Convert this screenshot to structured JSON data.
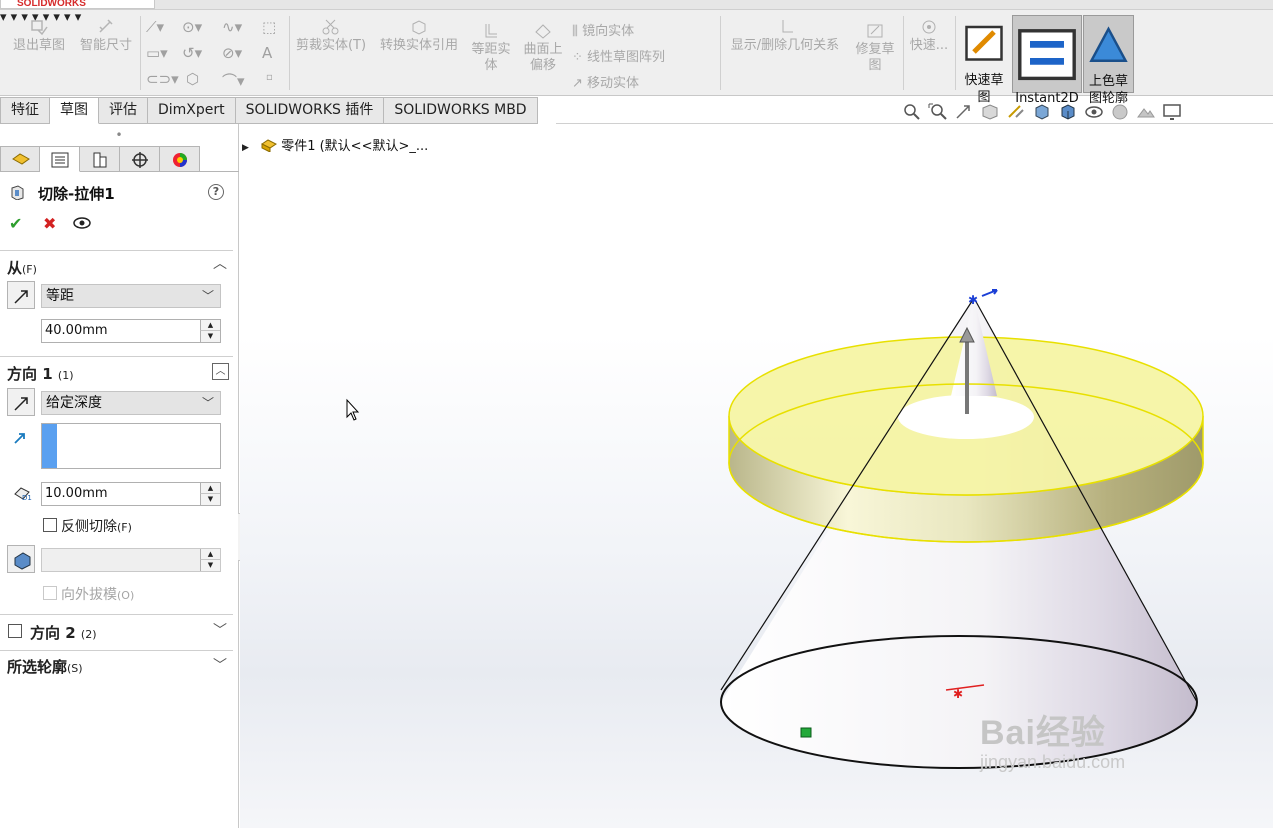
{
  "app": {
    "logo_text": "SOLIDWORKS"
  },
  "commands": {
    "exit_sketch": "退出草图",
    "smart_dim": "智能尺寸",
    "trim": "剪裁实体(T)",
    "convert": "转换实体引用",
    "offset_l1": "等距实",
    "offset_l2": "体",
    "surface_offset_l1": "曲面上",
    "surface_offset_l2": "偏移",
    "mirror": "镜向实体",
    "linear_pattern": "线性草图阵列",
    "move": "移动实体",
    "show_relations": "显示/删除几何关系",
    "repair_l1": "修复草",
    "repair_l2": "图",
    "quick": "快速...",
    "rapid_sketch_l1": "快速草",
    "rapid_sketch_l2": "图",
    "instant2d": "Instant2D",
    "shaded_l1": "上色草",
    "shaded_l2": "图轮廓"
  },
  "tabs": [
    "特征",
    "草图",
    "评估",
    "DimXpert",
    "SOLIDWORKS 插件",
    "SOLIDWORKS MBD"
  ],
  "pm": {
    "title": "切除-拉伸1",
    "from": {
      "label": "从",
      "key": "(F)",
      "type": "等距",
      "offset": "40.00mm"
    },
    "dir1": {
      "label": "方向 1",
      "key": "(1)",
      "type": "给定深度",
      "depth": "10.00mm",
      "flip_label": "反侧切除",
      "flip_key": "(F)",
      "draft_label": "向外拔模",
      "draft_key": "(O)"
    },
    "dir2": {
      "label": "方向 2",
      "key": "(2)"
    },
    "contours": {
      "label": "所选轮廓",
      "key": "(S)"
    }
  },
  "tree": {
    "root": "零件1  (默认<<默认>_..."
  },
  "watermark": {
    "brand": "Bai经验",
    "url": "jingyan.baidu.com"
  },
  "colors": {
    "accent_blue": "#5aa0f0",
    "ok_green": "#2e9e2e",
    "cancel_red": "#d32222",
    "disk_yellow": "#f4f39a"
  }
}
